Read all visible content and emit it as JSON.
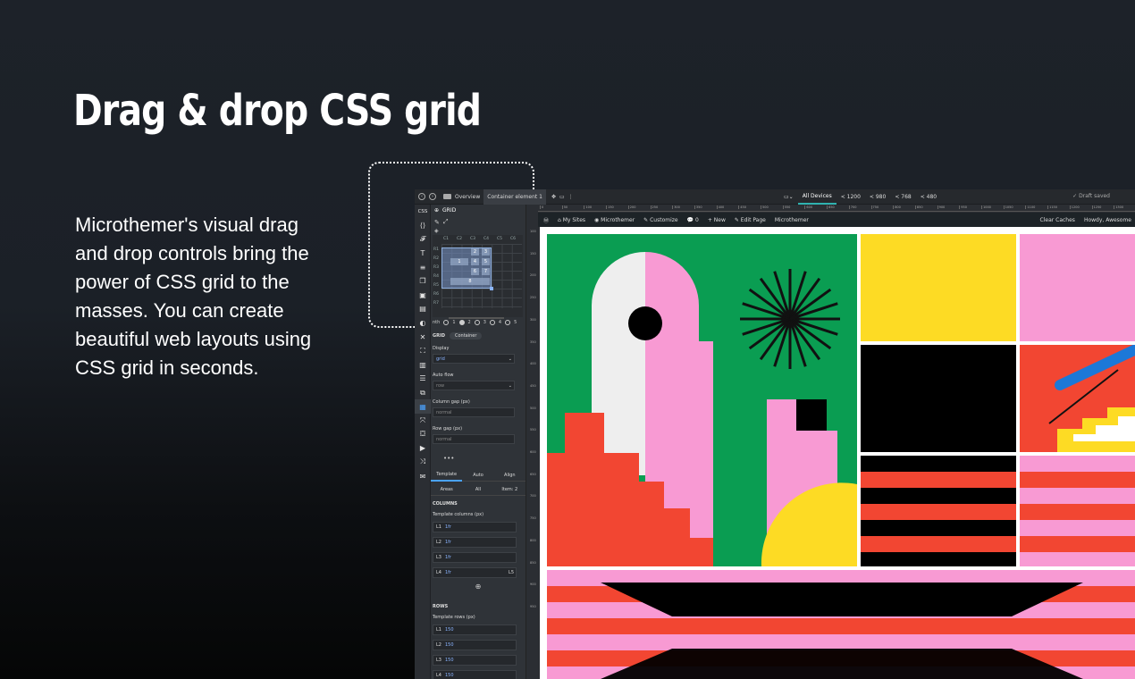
{
  "headline": "Drag & drop CSS grid",
  "body": "Microthemer's visual drag and drop controls bring the power of CSS grid to the masses. You can create beautiful web layouts using CSS grid in seconds.",
  "topbar": {
    "overview": "Overview",
    "container": "Container element 1",
    "devices": [
      "All Devices",
      "< 1200",
      "< 980",
      "< 768",
      "< 480"
    ],
    "draft": "Draft saved"
  },
  "rail": {
    "css": "CSS"
  },
  "panel": {
    "title": "GRID",
    "grid_cols": [
      "C1",
      "C2",
      "C3",
      "C4",
      "C5",
      "C6"
    ],
    "grid_rows": [
      "R1",
      "R2",
      "R3",
      "R4",
      "R5",
      "R6",
      "R7"
    ],
    "grid_cells": [
      "2",
      "3",
      "1",
      "4",
      "5",
      "6",
      "7",
      "8"
    ],
    "nth_label": "nth",
    "nth_options": [
      "1",
      "2",
      "3",
      "4",
      "5"
    ],
    "section": "GRID",
    "section_pill": "Container",
    "display_label": "Display",
    "display_value": "grid",
    "autoflow_label": "Auto flow",
    "autoflow_value": "row",
    "colgap_label": "Column gap (px)",
    "colgap_value": "normal",
    "rowgap_label": "Row gap (px)",
    "rowgap_value": "normal",
    "tabs": [
      "Template",
      "Auto",
      "Align"
    ],
    "tabs2": [
      "Areas",
      "All",
      "Item: 2"
    ],
    "columns_heading": "COLUMNS",
    "template_columns_label": "Template columns (px)",
    "columns": [
      {
        "line": "L1",
        "value": "1fr"
      },
      {
        "line": "L2",
        "value": "1fr"
      },
      {
        "line": "L3",
        "value": "1fr"
      },
      {
        "line": "L4",
        "value": "1fr",
        "end": "L5"
      }
    ],
    "add": "⊕",
    "rows_heading": "ROWS",
    "template_rows_label": "Template rows (px)",
    "rows": [
      {
        "line": "L1",
        "value": "150"
      },
      {
        "line": "L2",
        "value": "150"
      },
      {
        "line": "L3",
        "value": "150"
      },
      {
        "line": "L4",
        "value": "150"
      }
    ]
  },
  "ruler_ticks": [
    "0",
    "50",
    "100",
    "150",
    "200",
    "250",
    "300",
    "350",
    "400",
    "450",
    "500",
    "550",
    "600",
    "650",
    "700",
    "750",
    "800",
    "850",
    "900",
    "950",
    "1000",
    "1050",
    "1100",
    "1150",
    "1200",
    "1250",
    "1300"
  ],
  "ruler_v_ticks": [
    "100",
    "150",
    "200",
    "250",
    "300",
    "350",
    "400",
    "450",
    "500",
    "550",
    "600",
    "650",
    "700",
    "750",
    "800",
    "850",
    "900",
    "950"
  ],
  "wpbar": {
    "my_sites": "My Sites",
    "microthemer": "Microthemer",
    "customize": "Customize",
    "comments": "0",
    "new": "New",
    "edit_page": "Edit Page",
    "microthemer2": "Microthemer",
    "clear_caches": "Clear Caches",
    "howdy": "Howdy, Awesome"
  },
  "colors": {
    "green": "#0a9d52",
    "pink": "#f89ad3",
    "yellow": "#fddb24",
    "red": "#f24632",
    "black": "#000000",
    "blue": "#1c78d8"
  }
}
